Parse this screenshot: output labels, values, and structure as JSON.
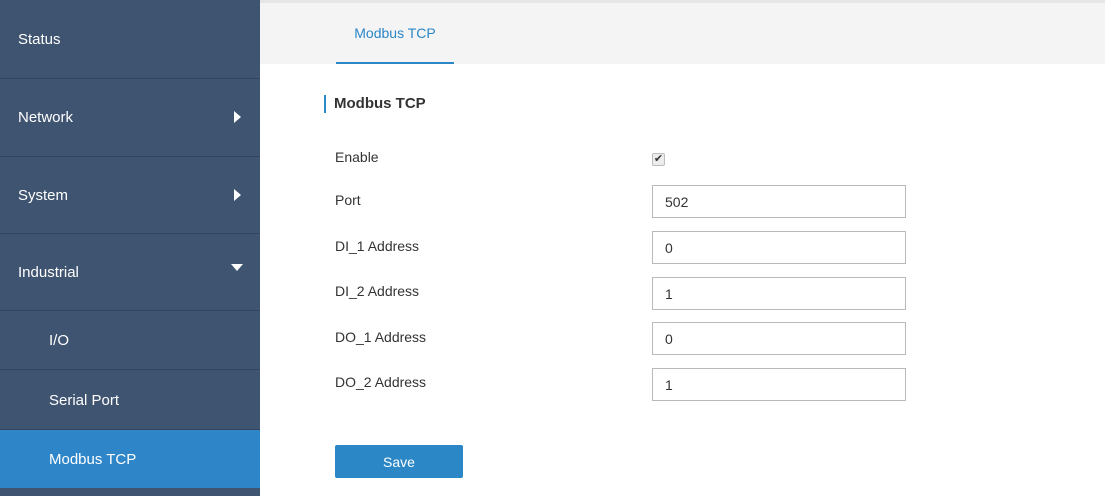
{
  "sidebar": {
    "items": [
      {
        "label": "Status"
      },
      {
        "label": "Network"
      },
      {
        "label": "System"
      },
      {
        "label": "Industrial"
      },
      {
        "label": "I/O"
      },
      {
        "label": "Serial Port"
      },
      {
        "label": "Modbus TCP"
      }
    ]
  },
  "tabs": [
    {
      "label": "Modbus TCP"
    }
  ],
  "section": {
    "title": "Modbus TCP"
  },
  "form": {
    "enable_label": "Enable",
    "enable_checked": true,
    "checkmark": "✔",
    "port_label": "Port",
    "port_value": "502",
    "di1_label": "DI_1 Address",
    "di1_value": "0",
    "di2_label": "DI_2 Address",
    "di2_value": "1",
    "do1_label": "DO_1 Address",
    "do1_value": "0",
    "do2_label": "DO_2 Address",
    "do2_value": "1",
    "save_label": "Save"
  },
  "colors": {
    "sidebar_bg": "#3f5470",
    "accent": "#2b87c6",
    "active_item": "#2e86c8"
  }
}
